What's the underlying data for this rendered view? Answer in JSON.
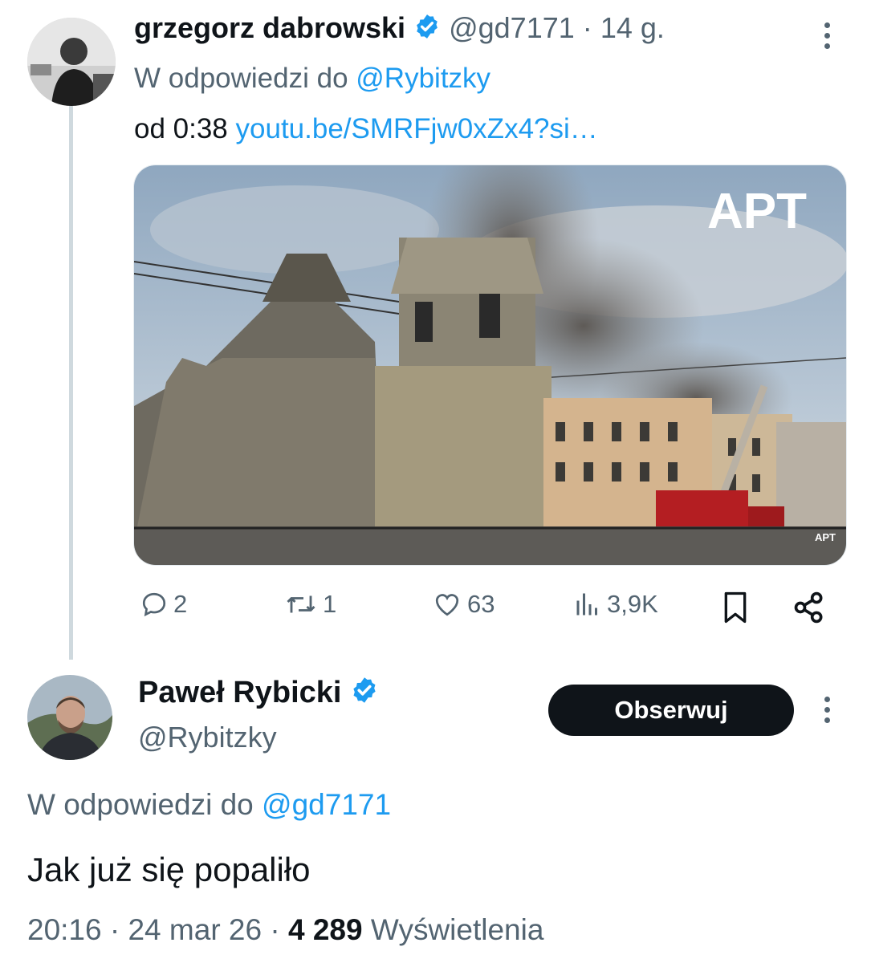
{
  "tweet1": {
    "author_name": "grzegorz dabrowski",
    "handle": "@gd7171",
    "separator": "·",
    "time": "14 g.",
    "reply_prefix": "W odpowiedzi do",
    "reply_to": "@Rybitzky",
    "text_prefix": "od 0:38",
    "link": "youtu.be/SMRFjw0xZx4?si…",
    "media_watermark": "APT",
    "media_watermark_small": "APT",
    "stats": {
      "replies": "2",
      "retweets": "1",
      "likes": "63",
      "views": "3,9K"
    },
    "icons": [
      "reply-icon",
      "retweet-icon",
      "like-icon",
      "views-icon",
      "bookmark-icon",
      "share-icon",
      "more-icon",
      "verified-icon"
    ]
  },
  "tweet2": {
    "author_name": "Paweł Rybicki",
    "handle": "@Rybitzky",
    "follow_label": "Obserwuj",
    "reply_prefix": "W odpowiedzi do",
    "reply_to": "@gd7171",
    "text": "Jak już się popaliło",
    "time": "20:16",
    "separator1": "·",
    "date": "24 mar 26",
    "separator2": "·",
    "views_count": "4 289",
    "views_label": "Wyświetlenia"
  },
  "colors": {
    "accent": "#1d9bf0",
    "text": "#0f1419",
    "muted": "#536471",
    "follow_bg": "#0f1419"
  }
}
